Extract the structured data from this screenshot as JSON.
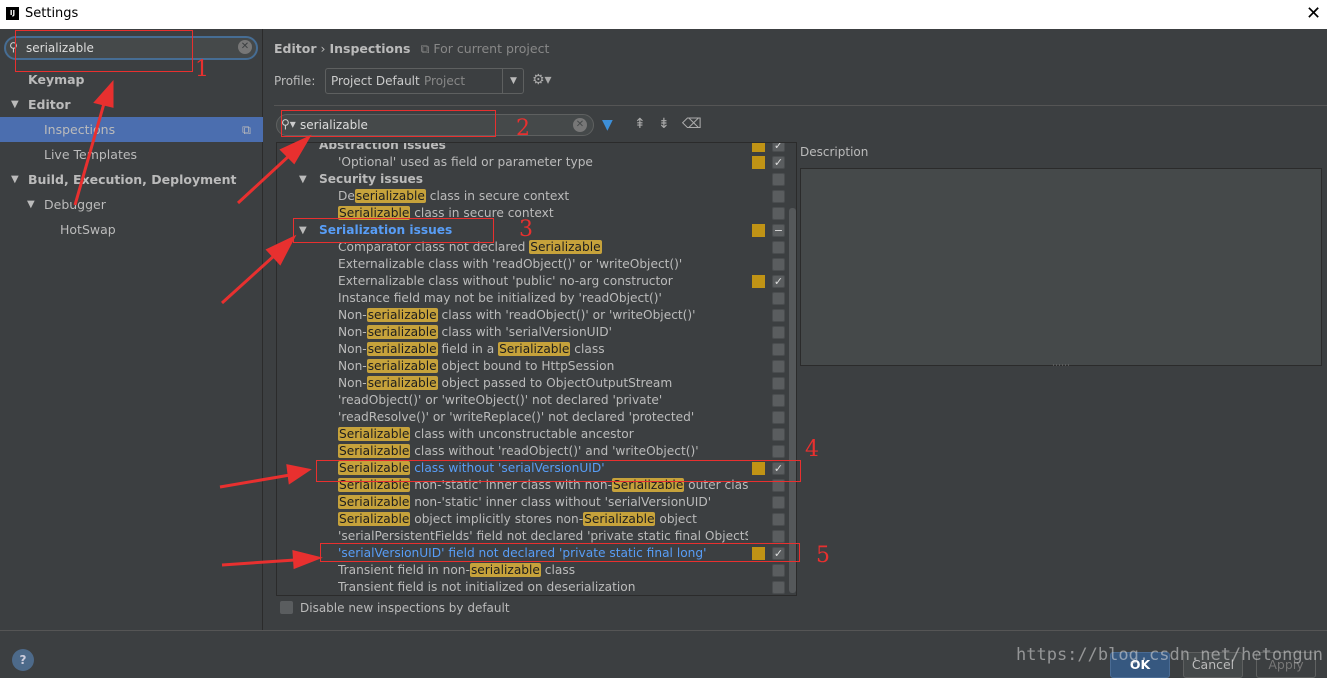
{
  "window": {
    "title": "Settings",
    "close": "✕",
    "logo": "IJ"
  },
  "sidebar": {
    "search_value": "serializable",
    "items": [
      {
        "label": "Keymap",
        "bold": true,
        "arrow": ""
      },
      {
        "label": "Editor",
        "bold": true,
        "arrow": "▼"
      },
      {
        "label": "Inspections",
        "selected": true,
        "arrow": ""
      },
      {
        "label": "Live Templates",
        "arrow": ""
      },
      {
        "label": "Build, Execution, Deployment",
        "bold": true,
        "arrow": "▼"
      },
      {
        "label": "Debugger",
        "arrow": "▼"
      },
      {
        "label": "HotSwap",
        "arrow": ""
      }
    ]
  },
  "header": {
    "breadcrumb_parent": "Editor",
    "separator": "›",
    "breadcrumb_current": "Inspections",
    "scope": "For current project"
  },
  "profile": {
    "label": "Profile:",
    "value": "Project Default",
    "scope": "Project"
  },
  "filter": {
    "search_value": "serializable"
  },
  "inspections": [
    {
      "parts": [
        {
          "t": "Abstraction issues"
        }
      ],
      "group": true,
      "sev": true,
      "check": "✓"
    },
    {
      "parts": [
        {
          "t": "'Optional' used as field or parameter type"
        }
      ],
      "sev": true,
      "check": "✓"
    },
    {
      "parts": [
        {
          "t": "Security issues"
        }
      ],
      "group": true,
      "check": ""
    },
    {
      "parts": [
        {
          "t": "De"
        },
        {
          "t": "serializable",
          "hl": true
        },
        {
          "t": " class in secure context"
        }
      ],
      "check": ""
    },
    {
      "parts": [
        {
          "t": "Serializable",
          "hl": true
        },
        {
          "t": " class in secure context"
        }
      ],
      "check": ""
    },
    {
      "parts": [
        {
          "t": "Serialization issues"
        }
      ],
      "group": true,
      "blue": true,
      "sev": true,
      "check": "−"
    },
    {
      "parts": [
        {
          "t": "Comparator class not declared "
        },
        {
          "t": "Serializable",
          "hl": true
        }
      ],
      "check": ""
    },
    {
      "parts": [
        {
          "t": "Externalizable class with 'readObject()' or 'writeObject()'"
        }
      ],
      "check": ""
    },
    {
      "parts": [
        {
          "t": "Externalizable class without 'public' no-arg constructor"
        }
      ],
      "sev": true,
      "check": "✓"
    },
    {
      "parts": [
        {
          "t": "Instance field may not be initialized by 'readObject()'"
        }
      ],
      "check": ""
    },
    {
      "parts": [
        {
          "t": "Non-"
        },
        {
          "t": "serializable",
          "hl": true
        },
        {
          "t": " class with 'readObject()' or 'writeObject()'"
        }
      ],
      "check": ""
    },
    {
      "parts": [
        {
          "t": "Non-"
        },
        {
          "t": "serializable",
          "hl": true
        },
        {
          "t": " class with 'serialVersionUID'"
        }
      ],
      "check": ""
    },
    {
      "parts": [
        {
          "t": "Non-"
        },
        {
          "t": "serializable",
          "hl": true
        },
        {
          "t": " field in a "
        },
        {
          "t": "Serializable",
          "hl": true
        },
        {
          "t": " class"
        }
      ],
      "check": ""
    },
    {
      "parts": [
        {
          "t": "Non-"
        },
        {
          "t": "serializable",
          "hl": true
        },
        {
          "t": " object bound to HttpSession"
        }
      ],
      "check": ""
    },
    {
      "parts": [
        {
          "t": "Non-"
        },
        {
          "t": "serializable",
          "hl": true
        },
        {
          "t": " object passed to ObjectOutputStream"
        }
      ],
      "check": ""
    },
    {
      "parts": [
        {
          "t": "'readObject()' or 'writeObject()' not declared 'private'"
        }
      ],
      "check": ""
    },
    {
      "parts": [
        {
          "t": "'readResolve()' or 'writeReplace()' not declared 'protected'"
        }
      ],
      "check": ""
    },
    {
      "parts": [
        {
          "t": "Serializable",
          "hl": true
        },
        {
          "t": " class with unconstructable ancestor"
        }
      ],
      "check": ""
    },
    {
      "parts": [
        {
          "t": "Serializable",
          "hl": true
        },
        {
          "t": " class without 'readObject()' and 'writeObject()'"
        }
      ],
      "check": ""
    },
    {
      "parts": [
        {
          "t": "Serializable",
          "hl": true
        },
        {
          "t": " class without 'serialVersionUID'"
        }
      ],
      "blue": true,
      "sev": true,
      "check": "✓"
    },
    {
      "parts": [
        {
          "t": "Serializable",
          "hl": true
        },
        {
          "t": " non-'static' inner class with non-"
        },
        {
          "t": "Serializable",
          "hl": true
        },
        {
          "t": " outer class"
        }
      ],
      "check": ""
    },
    {
      "parts": [
        {
          "t": "Serializable",
          "hl": true
        },
        {
          "t": " non-'static' inner class without 'serialVersionUID'"
        }
      ],
      "check": ""
    },
    {
      "parts": [
        {
          "t": "Serializable",
          "hl": true
        },
        {
          "t": " object implicitly stores non-"
        },
        {
          "t": "Serializable",
          "hl": true
        },
        {
          "t": " object"
        }
      ],
      "check": ""
    },
    {
      "parts": [
        {
          "t": "'serialPersistentFields' field not declared 'private static final ObjectStrea"
        }
      ],
      "check": ""
    },
    {
      "parts": [
        {
          "t": "'serialVersionUID' field not declared 'private static final long'"
        }
      ],
      "blue": true,
      "sev": true,
      "check": "✓"
    },
    {
      "parts": [
        {
          "t": "Transient field in non-"
        },
        {
          "t": "serializable",
          "hl": true
        },
        {
          "t": " class"
        }
      ],
      "check": ""
    },
    {
      "parts": [
        {
          "t": "Transient field is not initialized on deserialization"
        }
      ],
      "check": ""
    }
  ],
  "disable_new_label": "Disable new inspections by default",
  "description": {
    "label": "Description"
  },
  "buttons": {
    "ok": "OK",
    "cancel": "Cancel",
    "apply": "Apply",
    "help": "?"
  },
  "annotations": [
    "1",
    "2",
    "3",
    "4",
    "5"
  ],
  "watermark": "https://blog.csdn.net/hetongun",
  "colors": {
    "accent": "#4b6eaf",
    "highlight": "#c6a23b",
    "severity": "#c09315",
    "annotation": "#e8302f",
    "link": "#589df6"
  }
}
